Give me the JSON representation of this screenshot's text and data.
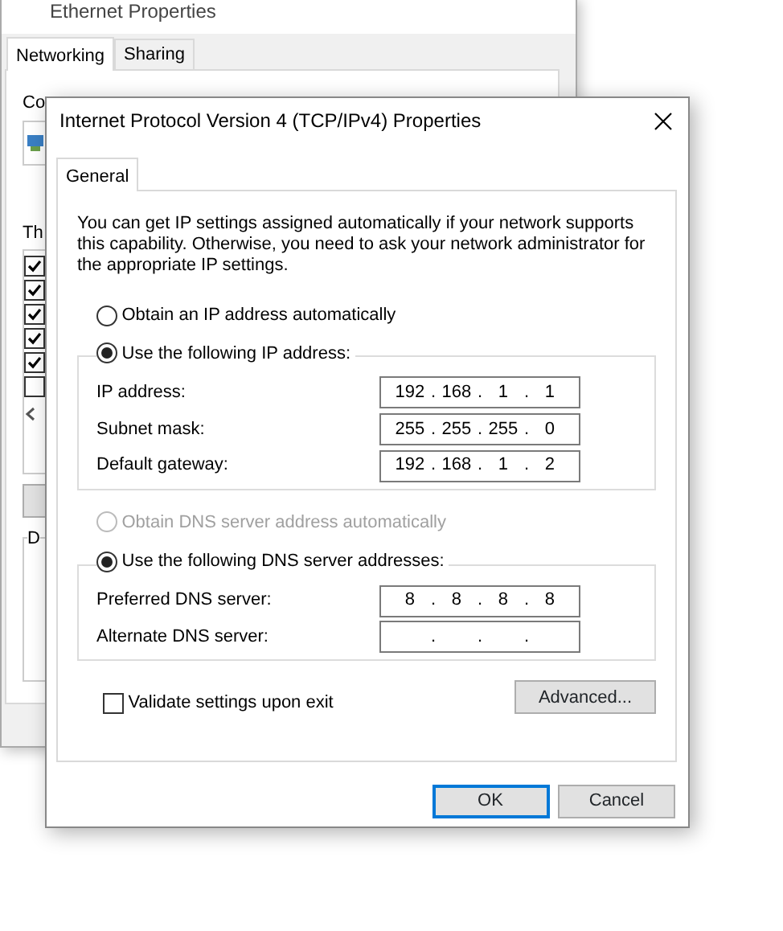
{
  "background_window": {
    "title": "Ethernet Properties",
    "tabs": [
      {
        "label": "Networking",
        "selected": true
      },
      {
        "label": "Sharing",
        "selected": false
      }
    ],
    "connect_label": "Co",
    "items_label": "Th",
    "group_label": "D",
    "list_items": [
      {
        "checked": true
      },
      {
        "checked": true
      },
      {
        "checked": true
      },
      {
        "checked": true
      },
      {
        "checked": true
      },
      {
        "checked": false
      }
    ]
  },
  "dialog": {
    "title": "Internet Protocol Version 4 (TCP/IPv4) Properties",
    "tabs": [
      {
        "label": "General",
        "selected": true
      }
    ],
    "description": "You can get IP settings assigned automatically if your network supports this capability. Otherwise, you need to ask your network administrator for the appropriate IP settings.",
    "ip_auto": {
      "label": "Obtain an IP address automatically",
      "selected": false,
      "disabled": false
    },
    "ip_manual": {
      "label": "Use the following IP address:",
      "selected": true,
      "disabled": false
    },
    "ip_fields": [
      {
        "label": "IP address:",
        "separator": ".",
        "octets": [
          "192",
          "168",
          "1",
          "1"
        ]
      },
      {
        "label": "Subnet mask:",
        "separator": ".",
        "octets": [
          "255",
          "255",
          "255",
          "0"
        ]
      },
      {
        "label": "Default gateway:",
        "separator": ".",
        "octets": [
          "192",
          "168",
          "1",
          "2"
        ]
      }
    ],
    "dns_auto": {
      "label": "Obtain DNS server address automatically",
      "selected": false,
      "disabled": true
    },
    "dns_manual": {
      "label": "Use the following DNS server addresses:",
      "selected": true,
      "disabled": false
    },
    "dns_fields": [
      {
        "label": "Preferred DNS server:",
        "separator": ".",
        "octets": [
          "8",
          "8",
          "8",
          "8"
        ]
      },
      {
        "label": "Alternate DNS server:",
        "separator": "."
      }
    ],
    "validate": {
      "label": "Validate settings upon exit",
      "checked": false
    },
    "advanced_button": "Advanced...",
    "buttons": [
      {
        "label": "OK",
        "default": true
      },
      {
        "label": "Cancel",
        "default": false
      }
    ]
  }
}
